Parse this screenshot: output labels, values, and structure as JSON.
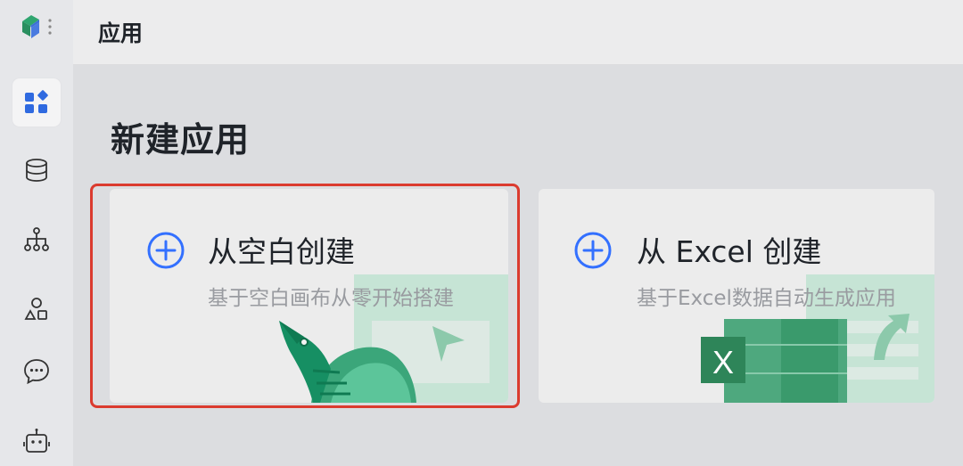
{
  "header": {
    "title": "应用"
  },
  "sidebar": {
    "items": [
      {
        "icon": "apps-grid-icon",
        "active": true
      },
      {
        "icon": "database-icon",
        "active": false
      },
      {
        "icon": "workflow-icon",
        "active": false
      },
      {
        "icon": "shapes-icon",
        "active": false
      },
      {
        "icon": "chat-bubble-icon",
        "active": false
      },
      {
        "icon": "robot-icon",
        "active": false
      }
    ]
  },
  "main": {
    "section_title": "新建应用",
    "cards": [
      {
        "title": "从空白创建",
        "description": "基于空白画布从零开始搭建",
        "selected": true
      },
      {
        "title": "从 Excel 创建",
        "description": "基于Excel数据自动生成应用",
        "excel_letter": "X"
      }
    ]
  },
  "colors": {
    "accent": "#3370ff",
    "highlight": "#db3b2f",
    "green": "#2e9a6e"
  }
}
